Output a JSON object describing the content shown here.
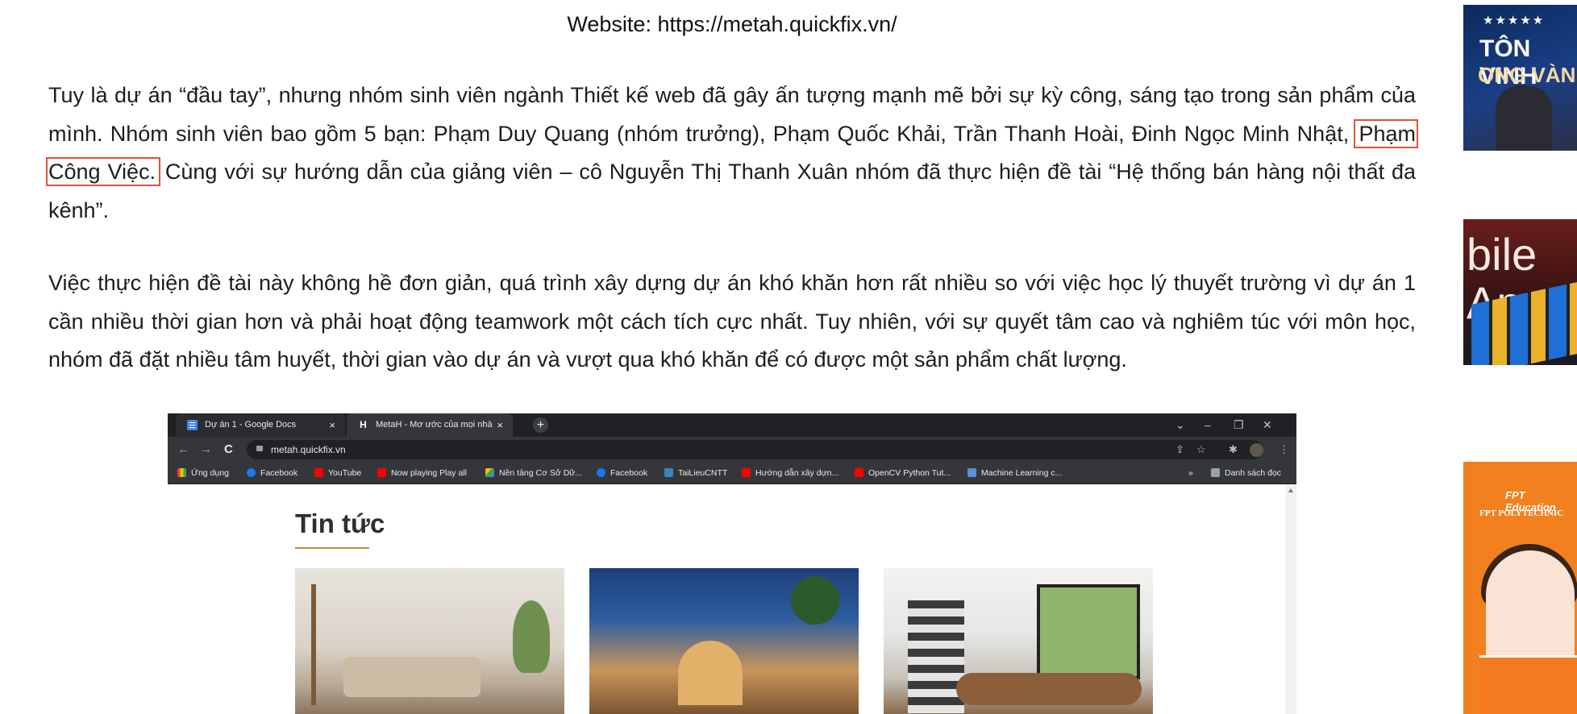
{
  "article": {
    "website_line": "Website: https://metah.quickfix.vn/",
    "paragraph1": {
      "before": "Tuy là dự án “đầu tay”, nhưng nhóm sinh viên ngành Thiết kế web đã gây ấn tượng mạnh mẽ bởi sự  kỳ công, sáng tạo trong sản phẩm của mình. Nhóm sinh viên bao gồm 5 bạn: Phạm Duy Quang (nhóm trưởng), Phạm Quốc Khải, Trần Thanh Hoài, Đinh Ngọc Minh Nhật, ",
      "highlight": "Phạm Công Việc.",
      "after": " Cùng với sự hướng dẫn của giảng viên – cô Nguyễn Thị Thanh Xuân nhóm đã thực hiện đề tài “Hệ thống bán hàng nội thất đa kênh”."
    },
    "paragraph2": "Việc thực hiện đề tài này không hề đơn giản, quá trình xây dựng dự án khó khăn hơn rất nhiều so với việc học lý thuyết trường vì dự án 1 cần nhiều thời gian hơn và phải hoạt động teamwork một cách tích cực nhất. Tuy nhiên, với sự quyết tâm cao và nghiêm túc với môn học, nhóm đã đặt nhiều tâm huyết, thời gian vào dự án và vượt qua khó khăn để có được một sản phẩm chất lượng."
  },
  "browser_screenshot": {
    "tabs": [
      {
        "label": "Dự án 1 - Google Docs",
        "icon": "docs-icon"
      },
      {
        "label": "MetaH - Mơ ước của mọi nhà",
        "icon": "metah-icon"
      }
    ],
    "tab_close": "×",
    "new_tab": "+",
    "window_controls": {
      "menu": "⌄",
      "minimize": "–",
      "restore": "❐",
      "close": "✕"
    },
    "nav": {
      "back": "←",
      "forward": "→",
      "reload": "C"
    },
    "address": "metah.quickfix.vn",
    "toolbar_icons": {
      "share": "⇪",
      "star": "☆",
      "extensions": "✱",
      "menu": "⋮"
    },
    "bookmarks": [
      {
        "label": "Ứng dụng",
        "icon": "apps"
      },
      {
        "label": "Facebook",
        "icon": "fb"
      },
      {
        "label": "YouTube",
        "icon": "yt"
      },
      {
        "label": "Now playing Play all",
        "icon": "yt"
      },
      {
        "label": "Nền tảng Cơ Sở Dữ...",
        "icon": "drive"
      },
      {
        "label": "Facebook",
        "icon": "fb"
      },
      {
        "label": "TaiLieuCNTT",
        "icon": "tl"
      },
      {
        "label": "Hướng dẫn xây dựn...",
        "icon": "yt"
      },
      {
        "label": "OpenCV Python Tut...",
        "icon": "yt"
      },
      {
        "label": "Machine Learning c...",
        "icon": "ml"
      }
    ],
    "bookmarks_more": "»",
    "reading_list": "Danh sách đọc",
    "page": {
      "heading": "Tin tức"
    }
  },
  "side_thumbnails": {
    "thumb1": {
      "stars": "★★★★★",
      "line1": "TÔN VINH",
      "line2": "ONG VÀN"
    },
    "thumb2": {
      "text": "bile Ap"
    },
    "thumb3": {
      "brand": "FPT Education",
      "school": "FPT POLYTECHNIC"
    }
  },
  "colors": {
    "highlight_border": "#e0533a",
    "heading_underline": "#c98b3a",
    "chrome_dark": "#202124",
    "fpt_orange": "#f2801f"
  }
}
